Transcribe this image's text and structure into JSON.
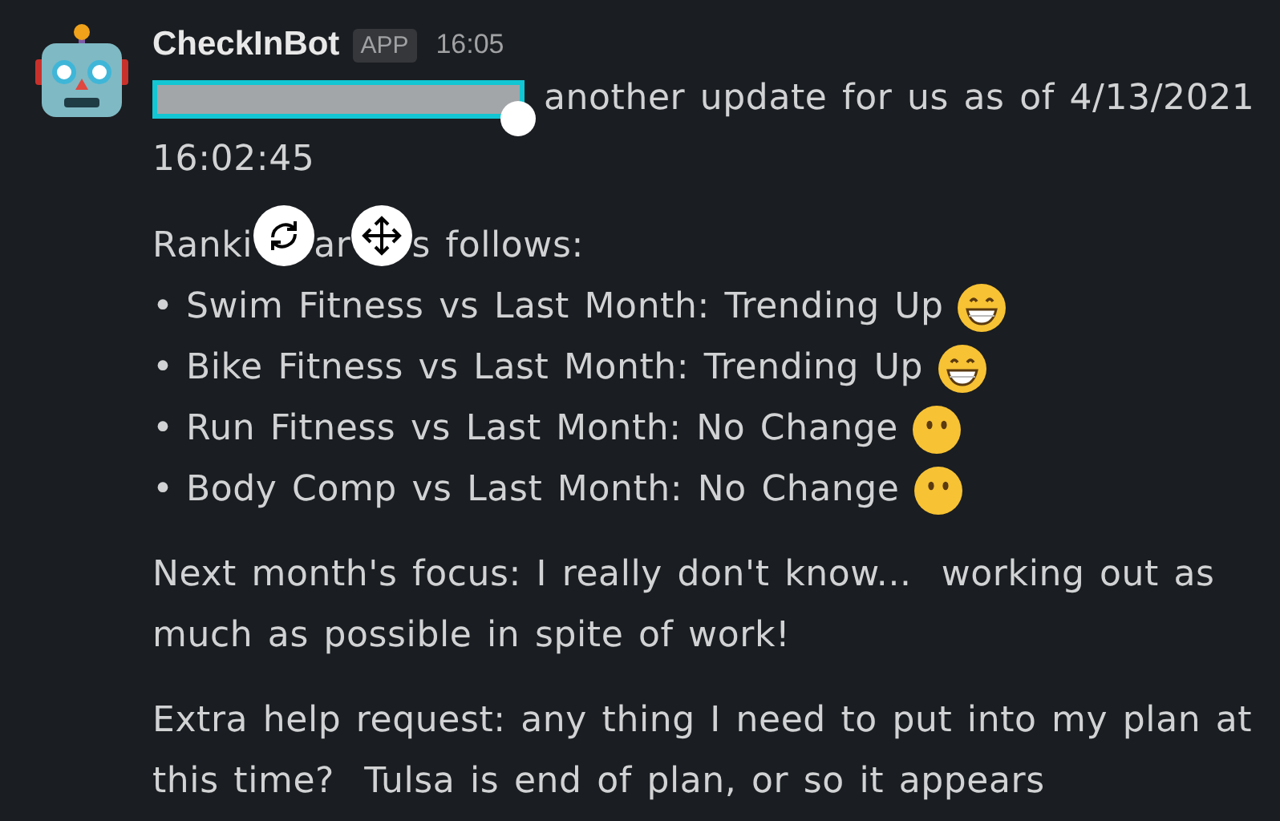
{
  "message": {
    "sender": "CheckInBot",
    "badge": "APP",
    "time": "16:05",
    "intro": {
      "redacted": true,
      "lines": [
        "another update for us as of 4/13/2021",
        "16:02:45"
      ]
    },
    "heading": [
      {
        "kind": "text",
        "text": "Ranki"
      },
      {
        "kind": "rotate-handle"
      },
      {
        "kind": "text",
        "text": "ar"
      },
      {
        "kind": "move-handle"
      },
      {
        "kind": "text",
        "text": "s follows:"
      }
    ],
    "bullets": [
      {
        "marker": "•",
        "text": "Swim Fitness vs Last Month: Trending Up",
        "kind": "grin"
      },
      {
        "marker": "•",
        "text": "Bike Fitness vs Last Month: Trending Up",
        "kind": "grin"
      },
      {
        "marker": "•",
        "text": "Run Fitness vs Last Month: No Change",
        "kind": "no-mouth"
      },
      {
        "marker": "•",
        "text": "Body Comp vs Last Month: No Change",
        "kind": "no-mouth"
      }
    ],
    "paragraphs": [
      "Next month's focus: I really don't know...  working out as much as possible in spite of work!",
      "Extra help request: any thing I need to put into my plan at this time?  Tulsa is end of plan, or so it appears"
    ]
  }
}
